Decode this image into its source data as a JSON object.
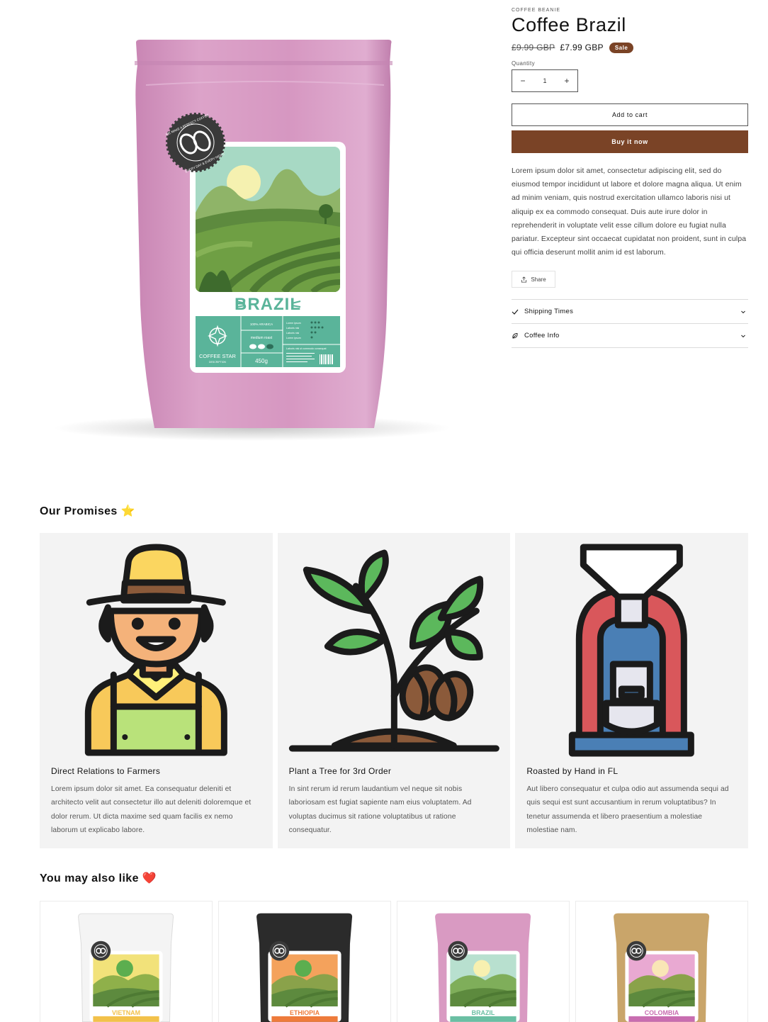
{
  "product": {
    "vendor": "COFFEE BEANIE",
    "title": "Coffee Brazil",
    "price_regular": "£9.99 GBP",
    "price_sale": "£7.99 GBP",
    "sale_badge": "Sale",
    "quantity_label": "Quantity",
    "quantity_value": "1",
    "quantity_minus": "−",
    "quantity_plus": "+",
    "add_to_cart": "Add to cart",
    "buy_now": "Buy it now",
    "description": "Lorem ipsum dolor sit amet, consectetur adipiscing elit, sed do eiusmod tempor incididunt ut labore et dolore magna aliqua. Ut enim ad minim veniam, quis nostrud exercitation ullamco laboris nisi ut aliquip ex ea commodo consequat. Duis aute irure dolor in reprehenderit in voluptate velit esse cillum dolore eu fugiat nulla pariatur. Excepteur sint occaecat cupidatat non proident, sunt in culpa qui officia deserunt mollit anim id est laborum.",
    "share": "Share",
    "accordion": [
      {
        "label": "Shipping Times",
        "icon": "check-icon"
      },
      {
        "label": "Coffee Info",
        "icon": "leaf-icon"
      }
    ],
    "colors": {
      "accent": "#7a4326",
      "bag": "#d99ac2"
    }
  },
  "package": {
    "stamp_top": "WE MAKE A PERFECT COFFEE",
    "stamp_bottom": "EVERY DAY & EVERY NIGHT",
    "origin": "BRAZIL",
    "brand": "COFFEE STAR",
    "brand_sub": "DESCRIPTION",
    "arabica": "100% ARABICA",
    "roast": "medium roast",
    "weight": "450g",
    "attr_1": "Lorem ipsum",
    "attr_2": "Laboris nisi",
    "attr_3": "Laboris nisi",
    "attr_4": "Lorem ipsum",
    "attr_note": "Laboris nisi ut commodo consequat"
  },
  "promises": {
    "title": "Our Promises ⭐",
    "items": [
      {
        "title": "Direct Relations to Farmers",
        "text": "Lorem ipsum dolor sit amet. Ea consequatur deleniti et architecto velit aut consectetur illo aut deleniti doloremque et dolor rerum. Ut dicta maxime sed quam facilis ex nemo laborum ut explicabo labore.",
        "icon": "farmer-icon"
      },
      {
        "title": "Plant a Tree for 3rd Order",
        "text": "In sint rerum id rerum laudantium vel neque sit nobis laboriosam est fugiat sapiente nam eius voluptatem. Ad voluptas ducimus sit ratione voluptatibus ut ratione consequatur.",
        "icon": "coffee-plant-icon"
      },
      {
        "title": "Roasted by Hand in FL",
        "text": "Aut libero consequatur et culpa odio aut assumenda sequi ad quis sequi est sunt accusantium in rerum voluptatibus? In tenetur assumenda et libero praesentium a molestiae molestiae nam.",
        "icon": "coffee-roaster-icon"
      }
    ]
  },
  "related": {
    "title": "You may also like ❤️",
    "items": [
      {
        "label": "VIETNAM",
        "bag": "#f4f4f4",
        "sky": "#f2e27a",
        "sun": "#f6c531",
        "hill": "#8fb04a",
        "band": "#f2c14a"
      },
      {
        "label": "ETHIOPIA",
        "bag": "#2b2b2b",
        "sky": "#f4a25c",
        "sun": "#fbd069",
        "hill": "#8aa24a",
        "band": "#ee7b3b"
      },
      {
        "label": "BRAZIL",
        "bag": "#d99ac2",
        "sky": "#b8e0cf",
        "sun": "#f7f0b0",
        "hill": "#7fae5a",
        "band": "#6abfa3"
      },
      {
        "label": "COLOMBIA",
        "bag": "#c9a56a",
        "sky": "#e9a9d2",
        "sun": "#f9e6b6",
        "hill": "#8aa24a",
        "band": "#c86db0"
      }
    ]
  }
}
